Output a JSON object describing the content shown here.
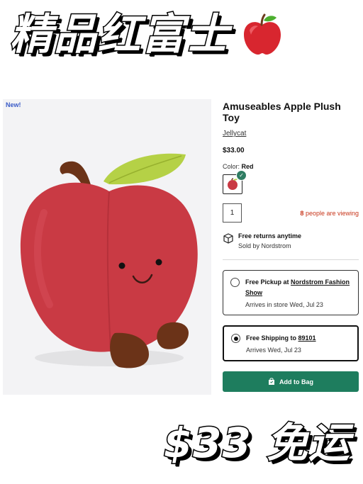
{
  "banner": {
    "headline": "精品红富士"
  },
  "image": {
    "badge": "New!"
  },
  "product": {
    "title": "Amuseables Apple Plush Toy",
    "brand": "Jellycat",
    "price": "$33.00",
    "color_label": "Color:",
    "color_value": "Red",
    "quantity": "1",
    "viewing_count": "8",
    "viewing_text": "people are viewing"
  },
  "returns": {
    "title": "Free returns anytime",
    "sold_by": "Sold by Nordstrom"
  },
  "pickup": {
    "label": "Free Pickup at",
    "store": "Nordstrom Fashion Show",
    "arrival": "Arrives in store Wed, Jul 23"
  },
  "shipping": {
    "label": "Free Shipping to",
    "zip": "89101",
    "arrival": "Arrives Wed, Jul 23"
  },
  "cart": {
    "button_label": "Add to Bag"
  },
  "footer_banner": {
    "text": "$33 免运"
  },
  "colors": {
    "accent_green": "#1e7d5e",
    "viewing_red": "#c8361b",
    "badge_blue": "#3a5bc7",
    "apple_red": "#d23a44"
  },
  "icons": [
    "apple-emoji-icon",
    "box-return-icon",
    "shopping-bag-icon",
    "check-icon"
  ]
}
